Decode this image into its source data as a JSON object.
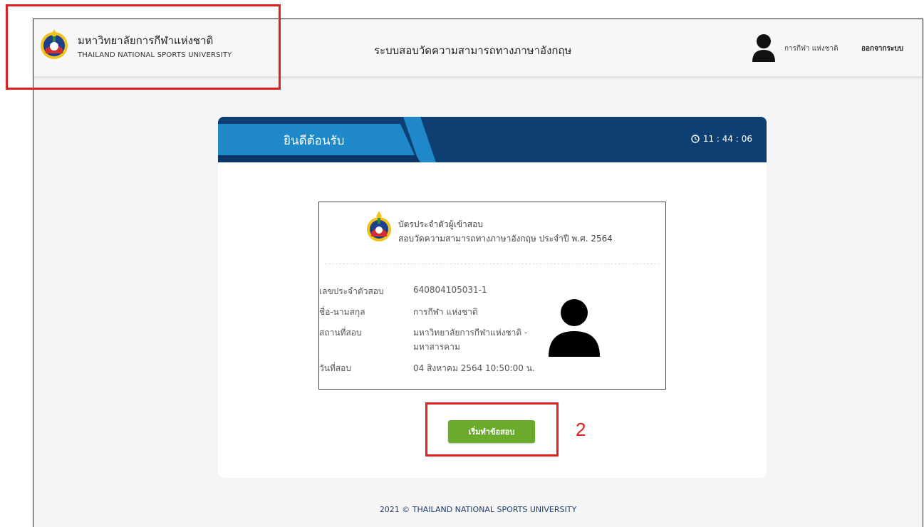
{
  "header": {
    "university_name_th": "มหาวิทยาลัยการกีฬาแห่งชาติ",
    "university_name_en": "THAILAND NATIONAL SPORTS UNIVERSITY",
    "system_title": "ระบบสอบวัดความสามารถทางภาษาอังกฤษ",
    "user_name": "การกีฬา แห่งชาติ",
    "logout_label": "ออกจากระบบ"
  },
  "welcome_card": {
    "title": "ยินดีต้อนรับ",
    "clock": "11 : 44 : 06",
    "header_color": "#0d3f73",
    "accent_color": "#1e88c8"
  },
  "exam_card": {
    "title": "บัตรประจำตัวผู้เข้าสอบ",
    "subtitle": "สอบวัดความสามารถทางภาษาอังกฤษ ประจำปี พ.ศ. 2564",
    "rows": [
      {
        "label": "เลขประจำตัวสอบ",
        "value": "640804105031-1"
      },
      {
        "label": "ชื่อ-นามสกุล",
        "value": "การกีฬา แห่งชาติ"
      },
      {
        "label": "สถานที่สอบ",
        "value": "มหาวิทยาลัยการกีฬาแห่งชาติ -",
        "value2": "มหาสารคาม"
      },
      {
        "label": "วันที่สอบ",
        "value": "04 สิงหาคม 2564 10:50:00 น."
      }
    ]
  },
  "start_button": {
    "label": "เริ่มทำข้อสอบ",
    "color": "#6aab2c"
  },
  "footer": {
    "text": "2021 © THAILAND NATIONAL SPORTS UNIVERSITY"
  },
  "annotation": {
    "step_number": "2",
    "color": "#e02020"
  }
}
